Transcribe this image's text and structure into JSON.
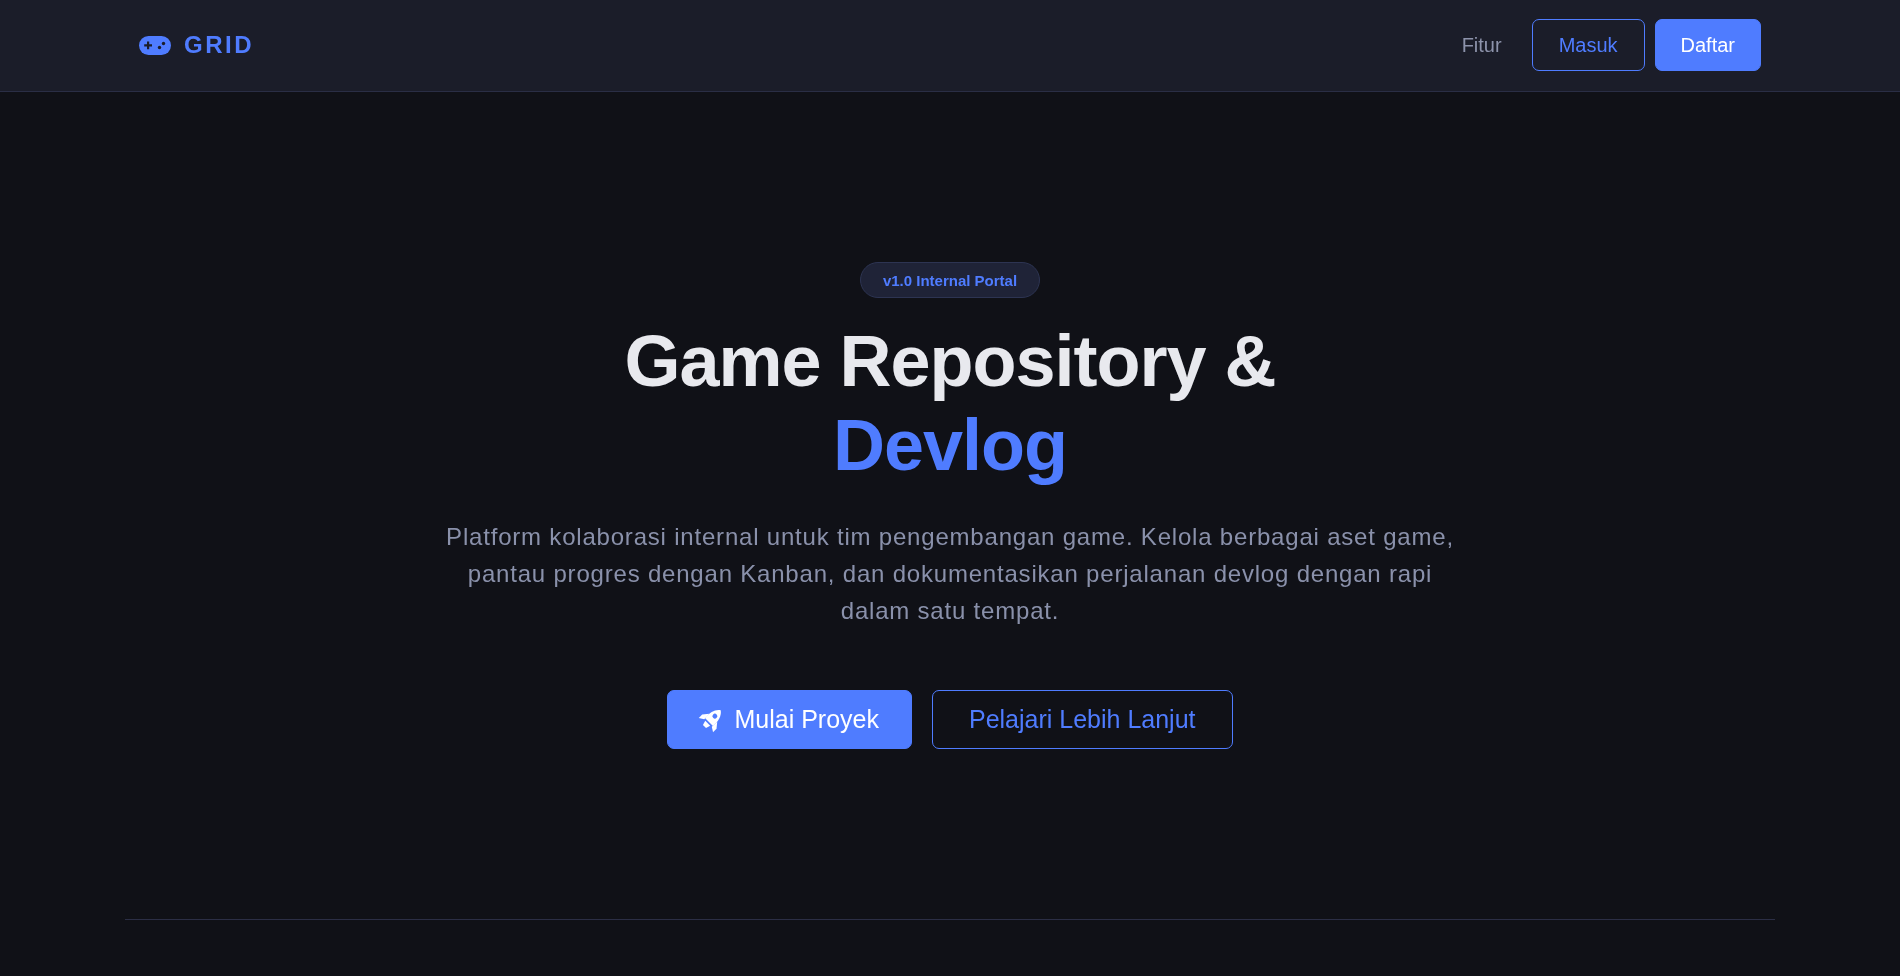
{
  "nav": {
    "brand": "GRID",
    "links": [
      {
        "label": "Fitur"
      }
    ],
    "login": "Masuk",
    "register": "Daftar"
  },
  "hero": {
    "badge": "v1.0 Internal Portal",
    "title": "Game Repository &",
    "title_highlight": "Devlog",
    "description": "Platform kolaborasi internal untuk tim pengembangan game. Kelola berbagai aset game, pantau progres dengan Kanban, dan dokumentasikan perjalanan devlog dengan rapi dalam satu tempat.",
    "primary_action": "Mulai Proyek",
    "secondary_action": "Pelajari Lebih Lanjut"
  }
}
